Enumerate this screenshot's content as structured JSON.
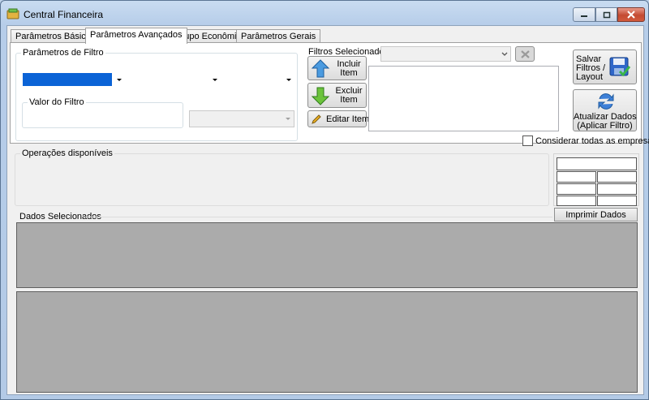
{
  "window": {
    "title": "Central Financeira"
  },
  "tabs": [
    {
      "label": "Parâmetros Básicos"
    },
    {
      "label": "Parâmetros Avançados"
    },
    {
      "label": "Grupo Econômico"
    },
    {
      "label": "Parâmetros Gerais"
    }
  ],
  "filtro": {
    "group_title": "Parâmetros de Filtro",
    "valor_title": "Valor do Filtro"
  },
  "filtros_selecionados": {
    "group_title": "Filtros Selecionados",
    "incluir": "Incluir\nItem",
    "excluir": "Excluir\nItem",
    "editar": "Editar Item"
  },
  "actions": {
    "salvar": "Salvar\nFiltros /\nLayout",
    "atualizar": "Atualizar Dados\n(Aplicar Filtro)",
    "considerar": "Considerar todas as empresas"
  },
  "operacoes": {
    "title": "Operações disponíveis"
  },
  "dados": {
    "title": "Dados Selecionados",
    "imprimir": "Imprimir Dados"
  },
  "colors": {
    "selection": "#0b63d6",
    "grid_bg": "#ababab"
  }
}
